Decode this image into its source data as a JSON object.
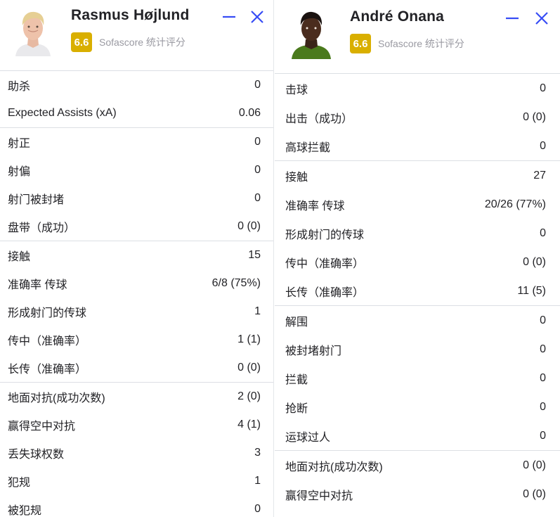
{
  "colors": {
    "rating_badge": "#d9af00",
    "accent_icon": "#374df5",
    "divider": "#dcdfe4",
    "muted_text": "#9a9aa2"
  },
  "players": [
    {
      "name": "Rasmus Højlund",
      "rating": "6.6",
      "rating_source": "Sofascore 统计评分",
      "icons": {
        "minimize": "minimize-icon",
        "close": "close-icon"
      },
      "groups": [
        [
          {
            "label": "助杀",
            "value": "0"
          },
          {
            "label": "Expected Assists (xA)",
            "value": "0.06"
          }
        ],
        [
          {
            "label": "射正",
            "value": "0"
          },
          {
            "label": "射偏",
            "value": "0"
          },
          {
            "label": "射门被封堵",
            "value": "0"
          },
          {
            "label": "盘带（成功）",
            "value": "0 (0)"
          }
        ],
        [
          {
            "label": "接触",
            "value": "15"
          },
          {
            "label": "准确率 传球",
            "value": "6/8 (75%)"
          },
          {
            "label": "形成射门的传球",
            "value": "1"
          },
          {
            "label": "传中（准确率）",
            "value": "1 (1)"
          },
          {
            "label": "长传（准确率）",
            "value": "0 (0)"
          }
        ],
        [
          {
            "label": "地面对抗(成功次数)",
            "value": "2 (0)"
          },
          {
            "label": "赢得空中对抗",
            "value": "4 (1)"
          },
          {
            "label": "丢失球权数",
            "value": "3"
          },
          {
            "label": "犯规",
            "value": "1"
          },
          {
            "label": "被犯规",
            "value": "0"
          }
        ]
      ]
    },
    {
      "name": "André Onana",
      "rating": "6.6",
      "rating_source": "Sofascore 统计评分",
      "icons": {
        "minimize": "minimize-icon",
        "close": "close-icon"
      },
      "groups": [
        [
          {
            "label": "击球",
            "value": "0"
          },
          {
            "label": "出击（成功）",
            "value": "0 (0)"
          },
          {
            "label": "高球拦截",
            "value": "0"
          }
        ],
        [
          {
            "label": "接触",
            "value": "27"
          },
          {
            "label": "准确率 传球",
            "value": "20/26 (77%)"
          },
          {
            "label": "形成射门的传球",
            "value": "0"
          },
          {
            "label": "传中（准确率）",
            "value": "0 (0)"
          },
          {
            "label": "长传（准确率）",
            "value": "11 (5)"
          }
        ],
        [
          {
            "label": "解围",
            "value": "0"
          },
          {
            "label": "被封堵射门",
            "value": "0"
          },
          {
            "label": "拦截",
            "value": "0"
          },
          {
            "label": "抢断",
            "value": "0"
          },
          {
            "label": "运球过人",
            "value": "0"
          }
        ],
        [
          {
            "label": "地面对抗(成功次数)",
            "value": "0 (0)"
          },
          {
            "label": "赢得空中对抗",
            "value": "0 (0)"
          }
        ]
      ]
    }
  ]
}
